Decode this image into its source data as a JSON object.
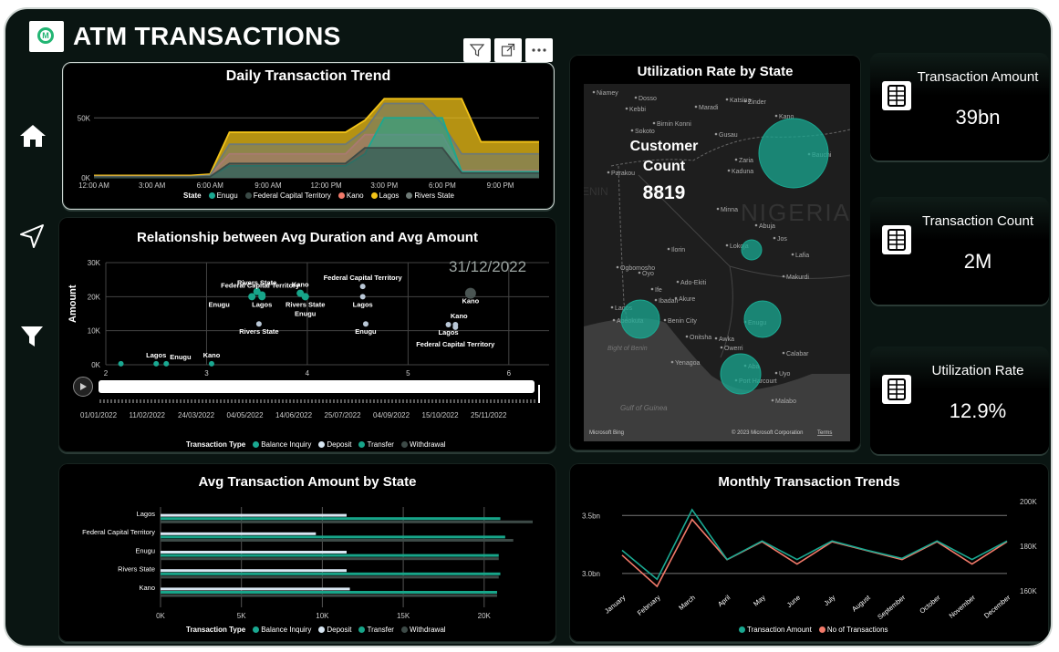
{
  "header": {
    "title": "ATM TRANSACTIONS",
    "logo_glyph": "M"
  },
  "colors": {
    "teal": "#1aa891",
    "dark": "#3a4a46",
    "salmon": "#f27a6a",
    "gold": "#f2c318",
    "grey": "#6e7a76",
    "balance": "#1aa891",
    "deposit": "#d8e6f2",
    "transfer": "#17a589",
    "withdrawal": "#3d4a47"
  },
  "nav": [
    {
      "icon": "home-icon"
    },
    {
      "icon": "navigate-icon"
    },
    {
      "icon": "filter-icon"
    }
  ],
  "toolbar": [
    "filter-icon",
    "expand-icon",
    "more-options-icon"
  ],
  "daily_trend": {
    "title": "Daily Transaction Trend",
    "legend_label": "State",
    "series_names": [
      "Enugu",
      "Federal Capital Territory",
      "Kano",
      "Lagos",
      "Rivers State"
    ],
    "chart_data": {
      "type": "area",
      "categories": [
        "12:00 AM",
        "3:00 AM",
        "6:00 AM",
        "9:00 AM",
        "12:00 PM",
        "3:00 PM",
        "6:00 PM",
        "9:00 PM"
      ],
      "y_ticks": [
        "0K",
        "50K"
      ],
      "hours": [
        0,
        1,
        2,
        3,
        4,
        5,
        6,
        7,
        8,
        9,
        10,
        11,
        12,
        13,
        14,
        15,
        16,
        17,
        18,
        19,
        20,
        21,
        22,
        23
      ],
      "ylim": [
        0,
        70000
      ],
      "series": [
        {
          "name": "Lagos",
          "values": [
            2000,
            2000,
            2000,
            2000,
            2000,
            2000,
            3000,
            38000,
            38000,
            38000,
            38000,
            38000,
            38000,
            38000,
            48000,
            66000,
            66000,
            66000,
            66000,
            66000,
            30000,
            30000,
            30000,
            30000
          ]
        },
        {
          "name": "Kano",
          "values": [
            1000,
            1000,
            1000,
            1000,
            1000,
            1000,
            2000,
            20000,
            20000,
            20000,
            20000,
            20000,
            20000,
            20000,
            36000,
            36000,
            36000,
            36000,
            36000,
            6000,
            6000,
            6000,
            6000,
            6000
          ]
        },
        {
          "name": "Rivers State",
          "values": [
            1000,
            1000,
            1000,
            1000,
            1000,
            1000,
            2000,
            28000,
            28000,
            28000,
            28000,
            28000,
            28000,
            28000,
            40000,
            62000,
            62000,
            62000,
            45000,
            20000,
            20000,
            20000,
            20000,
            20000
          ]
        },
        {
          "name": "Enugu",
          "values": [
            500,
            500,
            500,
            500,
            500,
            500,
            1000,
            10000,
            10000,
            10000,
            10000,
            10000,
            10000,
            10000,
            20000,
            50000,
            50000,
            50000,
            50000,
            5000,
            5000,
            5000,
            5000,
            5000
          ]
        },
        {
          "name": "Federal Capital Territory",
          "values": [
            500,
            500,
            500,
            500,
            500,
            500,
            1000,
            12000,
            12000,
            12000,
            12000,
            12000,
            12000,
            12000,
            25000,
            25000,
            25000,
            25000,
            25000,
            4000,
            4000,
            4000,
            4000,
            4000
          ]
        }
      ]
    }
  },
  "scatter": {
    "title": "Relationship between Avg Duration and Avg Amount",
    "date_label": "31/12/2022",
    "ylabel": "Amount",
    "dates": [
      "01/01/2022",
      "11/02/2022",
      "24/03/2022",
      "04/05/2022",
      "14/06/2022",
      "25/07/2022",
      "04/09/2022",
      "15/10/2022",
      "25/11/2022"
    ],
    "legend_title": "Transaction Type",
    "legend": [
      "Balance Inquiry",
      "Deposit",
      "Transfer",
      "Withdrawal"
    ],
    "chart_data": {
      "type": "scatter",
      "xlim": [
        2,
        6.4
      ],
      "ylim": [
        0,
        30000
      ],
      "x_ticks": [
        "2",
        "3",
        "4",
        "5",
        "6"
      ],
      "y_ticks": [
        "0K",
        "10K",
        "20K",
        "30K"
      ],
      "points": [
        {
          "label": "Lagos",
          "x": 2.5,
          "y": 300,
          "type": "Balance Inquiry",
          "pos": "above"
        },
        {
          "label": "Enugu",
          "x": 2.6,
          "y": 300,
          "type": "Balance Inquiry",
          "pos": "right"
        },
        {
          "label": "Kano",
          "x": 3.05,
          "y": 300,
          "type": "Balance Inquiry",
          "pos": "above"
        },
        {
          "label": "",
          "x": 2.15,
          "y": 300,
          "type": "Balance Inquiry",
          "pos": "none"
        },
        {
          "label": "Rivers State",
          "x": 3.5,
          "y": 21500,
          "type": "Transfer",
          "pos": "above"
        },
        {
          "label": "Federal Capital Territory",
          "x": 3.55,
          "y": 20500,
          "type": "Transfer",
          "pos": "left-above"
        },
        {
          "label": "Lagos",
          "x": 3.55,
          "y": 20000,
          "type": "Transfer",
          "pos": "below"
        },
        {
          "label": "Enugu",
          "x": 3.45,
          "y": 20000,
          "type": "Transfer",
          "pos": "below-left"
        },
        {
          "label": "Rivers State",
          "x": 3.52,
          "y": 12000,
          "type": "Deposit",
          "pos": "below"
        },
        {
          "label": "Kano",
          "x": 3.93,
          "y": 21000,
          "type": "Transfer",
          "pos": "above"
        },
        {
          "label": "Rivers State",
          "x": 3.98,
          "y": 20000,
          "type": "Transfer",
          "pos": "below"
        },
        {
          "label": "Enugu",
          "x": 3.98,
          "y": 20000,
          "type": "Transfer",
          "pos": "below2"
        },
        {
          "label": "Federal Capital Territory",
          "x": 4.55,
          "y": 23000,
          "type": "Deposit",
          "pos": "above"
        },
        {
          "label": "Lagos",
          "x": 4.55,
          "y": 20000,
          "type": "Deposit",
          "pos": "below"
        },
        {
          "label": "Enugu",
          "x": 4.58,
          "y": 12000,
          "type": "Deposit",
          "pos": "below"
        },
        {
          "label": "Kano",
          "x": 5.62,
          "y": 21000,
          "type": "Withdrawal",
          "pos": "below"
        },
        {
          "label": "Kano",
          "x": 5.47,
          "y": 11800,
          "type": "Deposit",
          "pos": "above-right"
        },
        {
          "label": "Lagos",
          "x": 5.4,
          "y": 11800,
          "type": "Deposit",
          "pos": "below"
        },
        {
          "label": "Federal Capital Territory",
          "x": 5.47,
          "y": 11000,
          "type": "Deposit",
          "pos": "below2"
        }
      ]
    }
  },
  "util_map": {
    "title": "Utilization Rate by State",
    "customer_count_label": "Customer Count",
    "customer_count_value": "8819",
    "attribution": "© 2023 Microsoft Corporation",
    "terms": "Terms",
    "bing": "Microsoft Bing",
    "country_label": "NIGERIA",
    "benin_label": "BENIN",
    "gulf_label": "Gulf of Guinea",
    "bight_label": "Bight of Benin",
    "place_labels": [
      "Niamey",
      "Dosso",
      "Birnin Konni",
      "Sokoto",
      "Maradi",
      "Zinder",
      "Gusau",
      "Kano",
      "Kaduna",
      "Parakou",
      "Jos",
      "Minna",
      "Abuja",
      "Ilorin",
      "Ogbomosho",
      "Oyo",
      "Ibadan",
      "Abeokuta",
      "Lagos",
      "Akure",
      "Ado-Ekiti",
      "Benin City",
      "Enugu",
      "Awka",
      "Onitsha",
      "Owerri",
      "Aba",
      "Uyo",
      "Yenagoa",
      "Port Harcourt",
      "Calabar",
      "Malabo",
      "Makurdi",
      "Lafia",
      "Lokoja",
      "Ife",
      "Kebbi",
      "Katsina",
      "Zaria",
      "Bauchi"
    ],
    "bubbles": [
      {
        "state": "Kano",
        "rate": 14.5
      },
      {
        "state": "Federal Capital Territory",
        "rate": 5.2
      },
      {
        "state": "Lagos",
        "rate": 9.7
      },
      {
        "state": "Enugu",
        "rate": 10.1
      },
      {
        "state": "Rivers State",
        "rate": 11.0
      }
    ]
  },
  "kpis": [
    {
      "label": "Transaction Amount",
      "value": "39bn"
    },
    {
      "label": "Transaction Count",
      "value": "2M"
    },
    {
      "label": "Utilization Rate",
      "value": "12.9%"
    }
  ],
  "avg_by_state": {
    "title": "Avg Transaction Amount by State",
    "legend_title": "Transaction Type",
    "legend": [
      "Balance Inquiry",
      "Deposit",
      "Transfer",
      "Withdrawal"
    ],
    "chart_data": {
      "type": "bar",
      "orientation": "horizontal",
      "categories": [
        "Lagos",
        "Federal Capital Territory",
        "Enugu",
        "Rivers State",
        "Kano"
      ],
      "xlim": [
        0,
        23000
      ],
      "x_ticks": [
        "0K",
        "5K",
        "10K",
        "15K",
        "20K"
      ],
      "series": [
        {
          "name": "Balance Inquiry",
          "values": [
            0,
            0,
            0,
            0,
            0
          ]
        },
        {
          "name": "Deposit",
          "values": [
            11500,
            9600,
            11500,
            11500,
            11700
          ]
        },
        {
          "name": "Transfer",
          "values": [
            21000,
            21300,
            20900,
            21000,
            20800
          ]
        },
        {
          "name": "Withdrawal",
          "values": [
            23000,
            21800,
            20900,
            20900,
            20800
          ]
        }
      ]
    }
  },
  "monthly": {
    "title": "Monthly Transaction Trends",
    "legend": [
      "Transaction Amount",
      "No of Transactions"
    ],
    "chart_data": {
      "type": "line",
      "categories": [
        "January",
        "February",
        "March",
        "April",
        "May",
        "June",
        "July",
        "August",
        "September",
        "October",
        "November",
        "December"
      ],
      "y_left_ticks": [
        "3.0bn",
        "3.5bn"
      ],
      "y_right_ticks": [
        "160K",
        "180K",
        "200K"
      ],
      "ylim_left": [
        2.85,
        3.62
      ],
      "ylim_right": [
        160000,
        200000
      ],
      "series": [
        {
          "name": "Transaction Amount",
          "values": [
            3.2,
            2.95,
            3.55,
            3.12,
            3.28,
            3.12,
            3.28,
            3.2,
            3.13,
            3.28,
            3.12,
            3.28
          ]
        },
        {
          "name": "No of Transactions",
          "values": [
            176000,
            162000,
            192000,
            174000,
            182000,
            172000,
            182000,
            178000,
            174000,
            182000,
            172000,
            182000
          ]
        }
      ]
    }
  }
}
